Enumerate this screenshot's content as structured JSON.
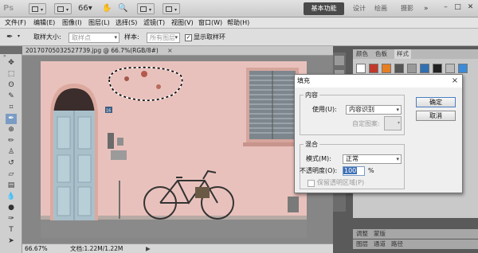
{
  "app": {
    "logo": "Ps",
    "workspaces": [
      "基本功能",
      "设计",
      "绘画",
      "摄影"
    ],
    "window_controls": [
      "–",
      "□",
      "✕"
    ]
  },
  "menu": [
    "文件(F)",
    "编辑(E)",
    "图像(I)",
    "图层(L)",
    "选择(S)",
    "滤镜(T)",
    "视图(V)",
    "窗口(W)",
    "帮助(H)"
  ],
  "options": {
    "sample_size_label": "取样大小:",
    "sample_size_value": "取样点",
    "sample_label": "样本:",
    "sample_value": "所有图层",
    "show_ring_label": "显示取样环",
    "show_ring_checked": true
  },
  "document": {
    "tab_title": "20170705032527739.jpg @ 66.7%(RGB/8#)",
    "close": "×",
    "zoom": "66.67%",
    "doc_info": "文档:1.22M/1.22M",
    "sign": "16"
  },
  "panels": {
    "tabs": [
      "颜色",
      "色板",
      "样式"
    ],
    "bottom_tabs_1": [
      "调整",
      "蒙版"
    ],
    "bottom_tabs_2": [
      "图层",
      "通道",
      "路径"
    ]
  },
  "dialog": {
    "title": "填充",
    "close": "×",
    "content_group": "内容",
    "use_label": "使用(U):",
    "use_value": "内容识别",
    "custom_pattern_label": "自定图案:",
    "blend_group": "混合",
    "mode_label": "模式(M):",
    "mode_value": "正常",
    "opacity_label": "不透明度(O):",
    "opacity_value": "100",
    "opacity_unit": "%",
    "preserve_label": "保留透明区域(P)",
    "preserve_checked": false,
    "ok_label": "确定",
    "cancel_label": "取消"
  },
  "colors": {
    "wall": "#e9c1bc",
    "selection": "#000000",
    "accent_dark": "#4a4a4a"
  }
}
